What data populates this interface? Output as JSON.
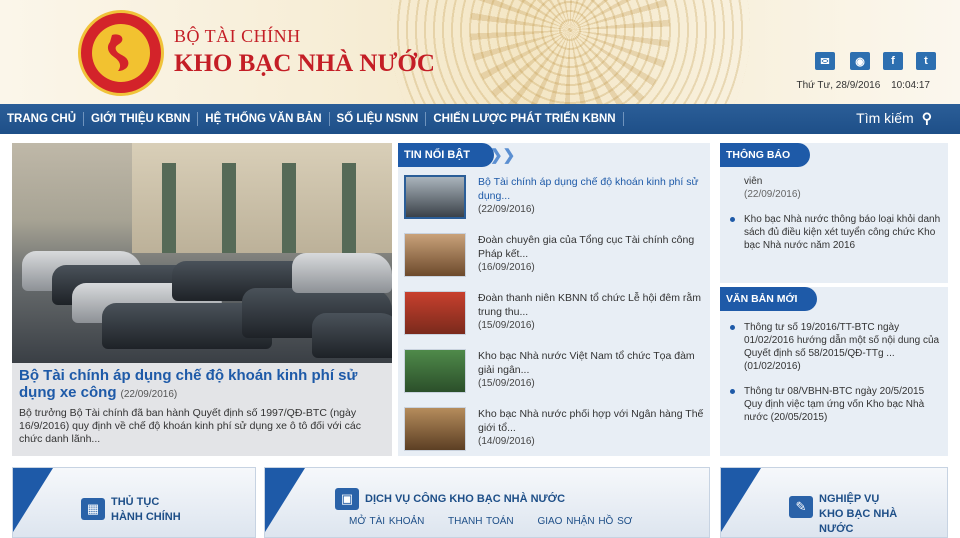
{
  "brand": {
    "ministry": "BỘ TÀI CHÍNH",
    "name": "KHO BẠC NHÀ NƯỚC"
  },
  "header": {
    "date": "Thứ Tư, 28/9/2016",
    "time": "10:04:17",
    "social": [
      "mail",
      "rss",
      "facebook",
      "twitter"
    ]
  },
  "nav": {
    "items": [
      "TRANG CHỦ",
      "GIỚI THIỆU KBNN",
      "HỆ THỐNG VĂN BẢN",
      "SỐ LIỆU NSNN",
      "CHIẾN LƯỢC PHÁT TRIỂN KBNN"
    ],
    "search_label": "Tìm kiếm"
  },
  "featured": {
    "title": "Bộ Tài chính áp dụng chế độ khoán kinh phí sử dụng xe công",
    "date": "(22/09/2016)",
    "description": "Bộ trưởng Bộ Tài chính đã ban hành Quyết định số 1997/QĐ-BTC (ngày 16/9/2016) quy định về chế độ khoán kinh phí sử dụng xe ô tô đối với các chức danh lãnh..."
  },
  "news": {
    "heading": "TIN NỔI BẬT",
    "items": [
      {
        "title": "Bộ Tài chính áp dụng chế độ khoán kinh phí sử dụng...",
        "date": "(22/09/2016)"
      },
      {
        "title": "Đoàn chuyên gia của Tổng cục Tài chính công Pháp kết...",
        "date": "(16/09/2016)"
      },
      {
        "title": "Đoàn thanh niên KBNN tổ chức Lễ hội đêm rằm trung thu...",
        "date": "(15/09/2016)"
      },
      {
        "title": "Kho bạc Nhà nước Việt Nam tổ chức Tọa đàm giải ngân...",
        "date": "(15/09/2016)"
      },
      {
        "title": "Kho bạc Nhà nước phối hợp với Ngân hàng Thế giới tổ...",
        "date": "(14/09/2016)"
      }
    ]
  },
  "announcements": {
    "heading": "THÔNG BÁO",
    "partial_text": "viên",
    "partial_date": "(22/09/2016)",
    "item_text": "Kho bạc Nhà nước thông báo loại khỏi danh sách đủ điều kiện xét tuyển công chức Kho bạc Nhà nước năm 2016"
  },
  "documents": {
    "heading": "VĂN BẢN MỚI",
    "items": [
      {
        "text": "Thông tư số 19/2016/TT-BTC ngày 01/02/2016 hướng dẫn một số nội dung của Quyết định số 58/2015/QĐ-TTg ...",
        "date": "(01/02/2016)"
      },
      {
        "text": "Thông tư 08/VBHN-BTC ngày 20/5/2015 Quy định việc tạm ứng vốn Kho bạc Nhà nước",
        "date": "(20/05/2015)"
      }
    ]
  },
  "panels": {
    "admin": {
      "line1": "THỦ TỤC",
      "line2": "HÀNH CHÍNH"
    },
    "public": {
      "title": "DỊCH VỤ CÔNG KHO BẠC NHÀ NƯỚC",
      "links": [
        "MỞ TÀI KHOẢN",
        "THANH TOÁN",
        "GIAO NHẬN HỒ SƠ"
      ]
    },
    "business": {
      "line1": "NGHIỆP VỤ",
      "line2": "KHO BẠC NHÀ",
      "line3": "NƯỚC"
    }
  }
}
